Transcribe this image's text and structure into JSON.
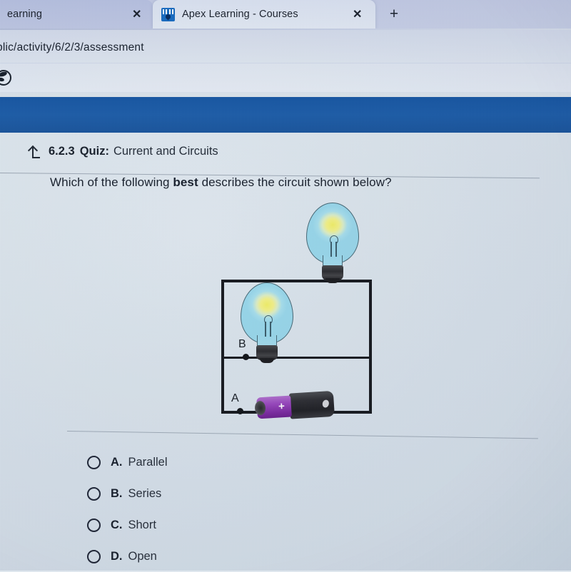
{
  "browser": {
    "tabs": [
      {
        "title": "earning",
        "favicon": "none",
        "active": false,
        "close_label": "✕"
      },
      {
        "title": "Apex Learning - Courses",
        "favicon": "apex-learning-favicon",
        "active": true,
        "close_label": "✕"
      }
    ],
    "new_tab_label": "+",
    "url": "blic/activity/6/2/3/assessment",
    "bookmark_icon": "globe-icon"
  },
  "app": {
    "header_color": "#1e5ca7",
    "background_color": "#dee7ef"
  },
  "quiz": {
    "return_icon": "return-arrow-icon",
    "number": "6.2.3",
    "label": "Quiz:",
    "name": "Current and Circuits",
    "question_prefix": "Which of the following ",
    "question_emphasis": "best",
    "question_suffix": " describes the circuit shown below?"
  },
  "figure": {
    "caption": "circuit-diagram",
    "node_a_label": "A",
    "node_b_label": "B",
    "battery_polarity": "+",
    "bulb_count": 2,
    "colors": {
      "wire": "#1a1d23",
      "bulb_glass": "#9bd9ec",
      "bulb_glow": "#f2f06a",
      "bulb_base": "#2e2f33",
      "battery_positive": "#9b49c0",
      "battery_body": "#2c2d33"
    }
  },
  "options": [
    {
      "letter": "A.",
      "text": "Parallel",
      "selected": false
    },
    {
      "letter": "B.",
      "text": "Series",
      "selected": false
    },
    {
      "letter": "C.",
      "text": "Short",
      "selected": false
    },
    {
      "letter": "D.",
      "text": "Open",
      "selected": false
    }
  ]
}
